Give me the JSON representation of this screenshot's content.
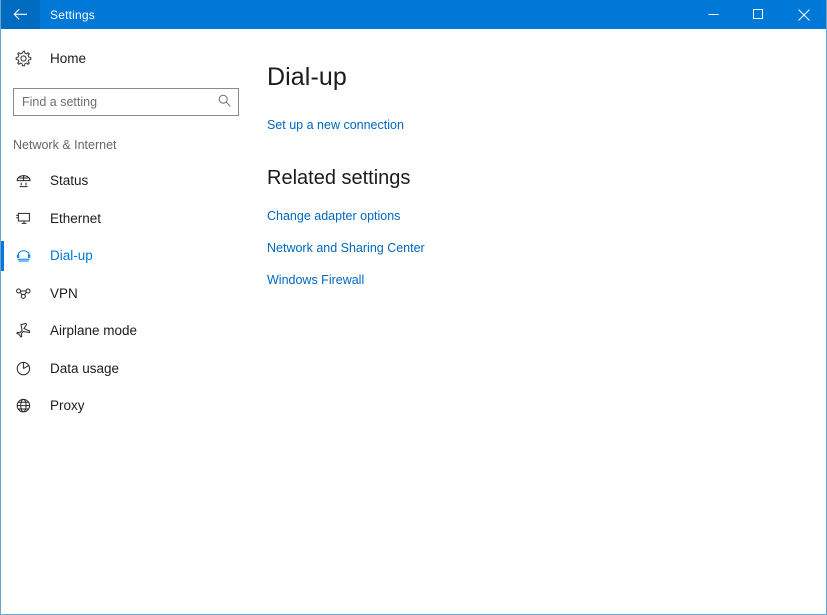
{
  "titlebar": {
    "back_icon": "back-arrow-icon",
    "title": "Settings",
    "minimize_icon": "minimize-icon",
    "maximize_icon": "maximize-icon",
    "close_icon": "close-icon",
    "background_color": "#0078d7"
  },
  "sidebar": {
    "home": {
      "label": "Home",
      "icon": "gear-icon"
    },
    "search": {
      "placeholder": "Find a setting",
      "value": "",
      "icon": "search-icon"
    },
    "section_label": "Network & Internet",
    "items": [
      {
        "label": "Status",
        "icon": "network-status-icon",
        "selected": false
      },
      {
        "label": "Ethernet",
        "icon": "ethernet-icon",
        "selected": false
      },
      {
        "label": "Dial-up",
        "icon": "dialup-icon",
        "selected": true
      },
      {
        "label": "VPN",
        "icon": "vpn-icon",
        "selected": false
      },
      {
        "label": "Airplane mode",
        "icon": "airplane-icon",
        "selected": false
      },
      {
        "label": "Data usage",
        "icon": "pie-chart-icon",
        "selected": false
      },
      {
        "label": "Proxy",
        "icon": "globe-icon",
        "selected": false
      }
    ],
    "accent_color": "#0078d7"
  },
  "main": {
    "page_title": "Dial-up",
    "primary_link": "Set up a new connection",
    "related_title": "Related settings",
    "related_links": [
      "Change adapter options",
      "Network and Sharing Center",
      "Windows Firewall"
    ],
    "link_color": "#0067c0"
  }
}
